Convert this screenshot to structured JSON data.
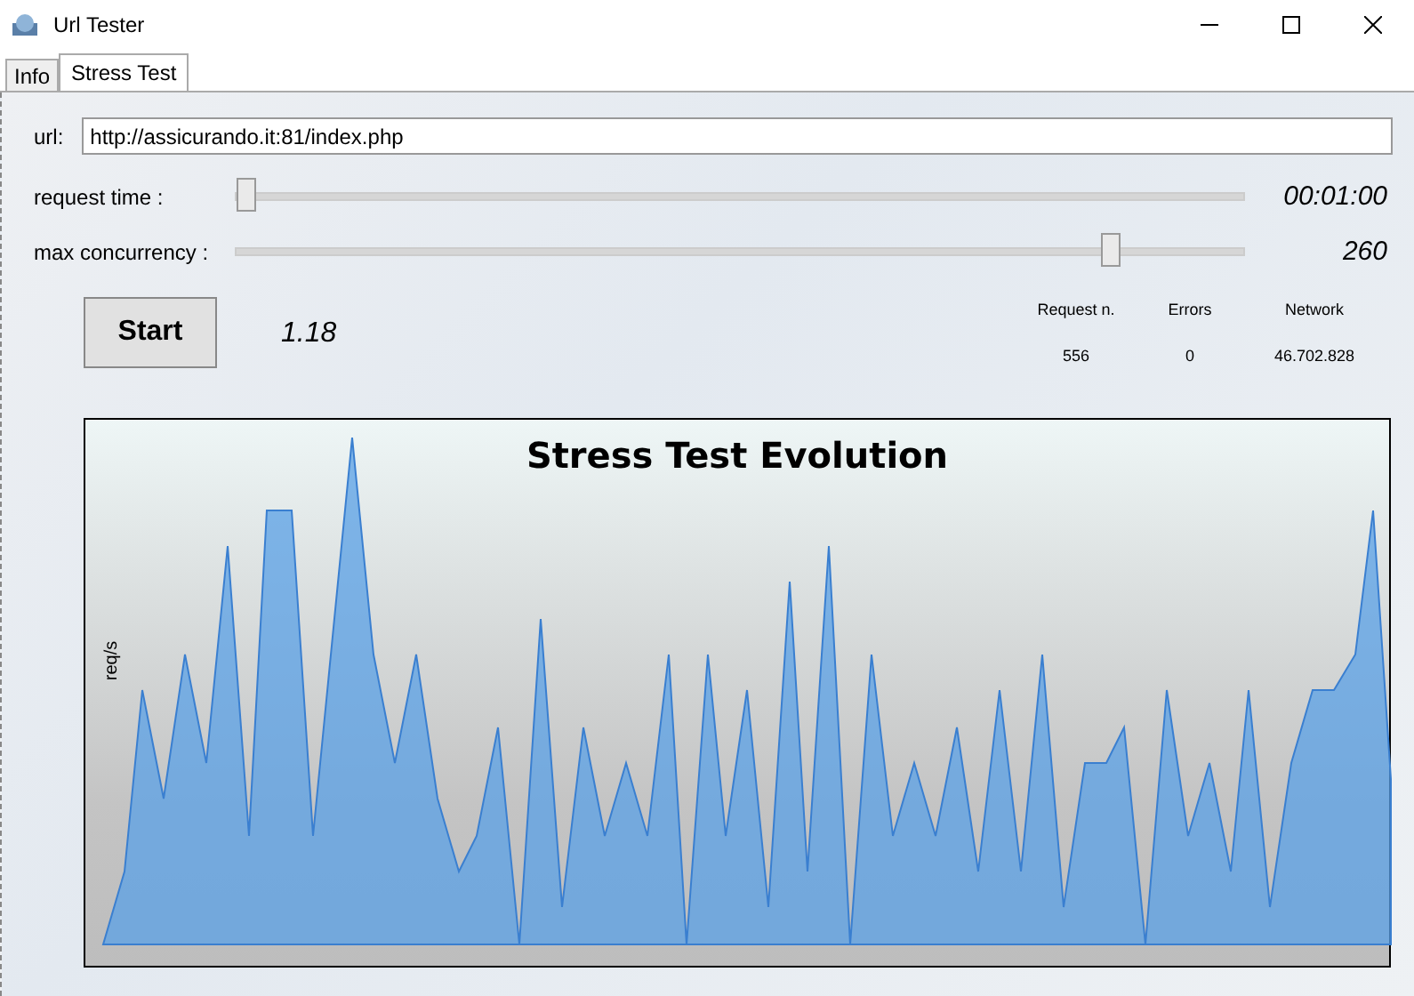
{
  "window": {
    "title": "Url Tester"
  },
  "tabs": [
    {
      "label": "Info",
      "selected": false
    },
    {
      "label": "Stress Test",
      "selected": true
    }
  ],
  "url": {
    "label": "url:",
    "value": "http://assicurando.it:81/index.php"
  },
  "sliders": [
    {
      "label": "request time :",
      "level": 0,
      "reading": "00:01:00"
    },
    {
      "label": "max concurrency :",
      "level": 0.87,
      "reading": "260"
    }
  ],
  "start_button": "Start",
  "rate": "1.18",
  "stats": [
    {
      "heading": "Request n.",
      "value": "556"
    },
    {
      "heading": "Errors",
      "value": "0"
    },
    {
      "heading": "Network",
      "value": "46.702.828"
    }
  ],
  "chart": {
    "title": "Stress Test Evolution",
    "ylabel": "req/s"
  }
}
